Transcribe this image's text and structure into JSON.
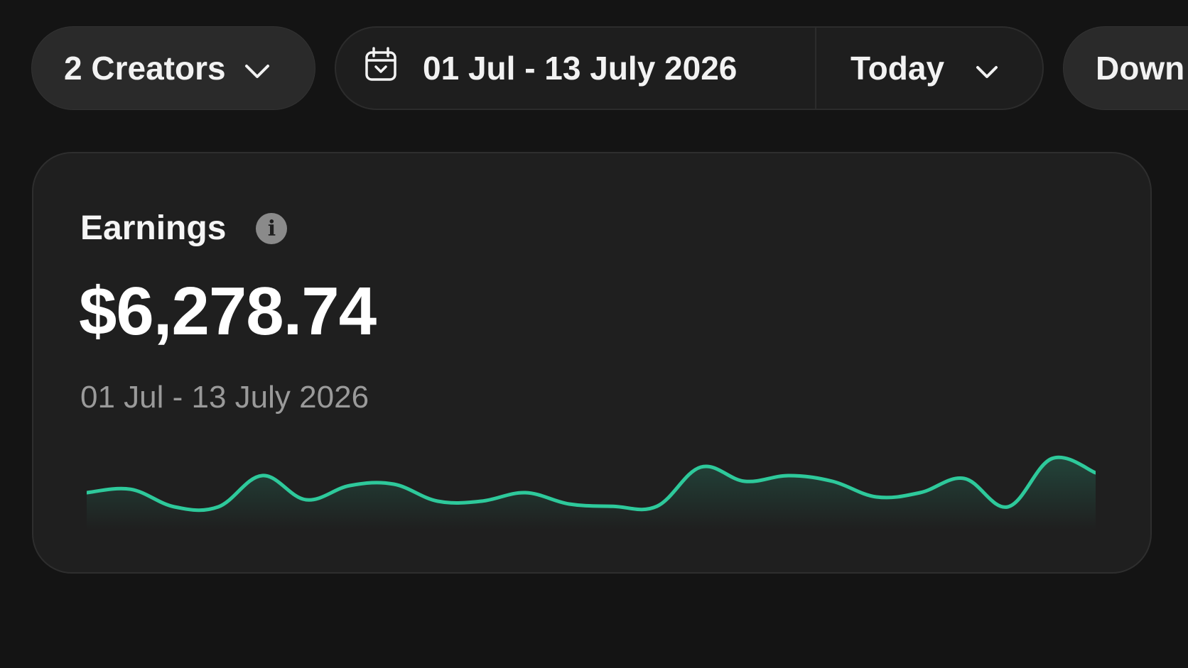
{
  "toolbar": {
    "creators_label": "2 Creators",
    "date_range": "01 Jul - 13 July 2026",
    "period": "Today",
    "download_label": "Down"
  },
  "card": {
    "title": "Earnings",
    "amount": "$6,278.74",
    "range": "01 Jul - 13 July 2026"
  },
  "colors": {
    "accent": "#2ec99b",
    "background": "#141414",
    "card": "#1f1f1f"
  },
  "chart_data": {
    "type": "area",
    "values": [
      0.6,
      0.72,
      0.1,
      0.1,
      1.2,
      0.35,
      0.85,
      0.9,
      0.3,
      0.3,
      0.6,
      0.2,
      0.12,
      0.12,
      1.5,
      1.0,
      1.2,
      1.0,
      0.45,
      0.6,
      1.1,
      0.1,
      1.8,
      1.3
    ],
    "grid": false,
    "legend": false
  }
}
